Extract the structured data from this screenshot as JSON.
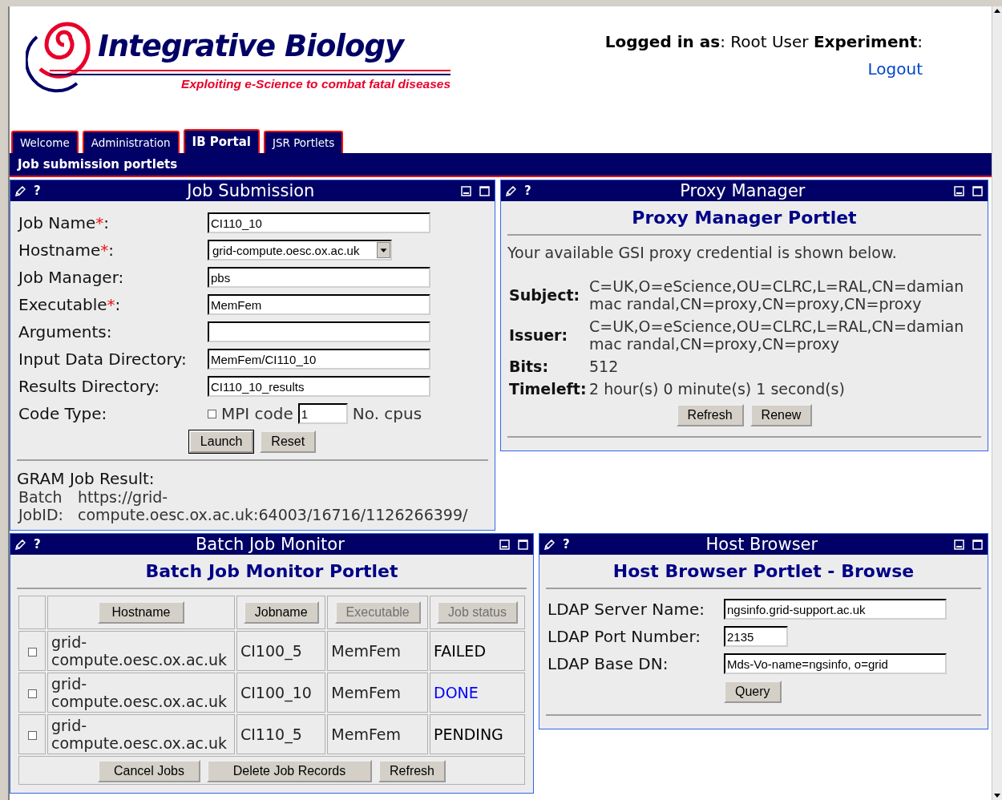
{
  "header": {
    "logo_title": "Integrative Biology",
    "logo_tagline": "Exploiting e-Science to combat fatal diseases",
    "login_text": "**Logged in as**: Root User **Experiment**:",
    "logout": "Logout"
  },
  "tabs": [
    {
      "label": "Welcome",
      "selected": false
    },
    {
      "label": "Administration",
      "selected": false
    },
    {
      "label": "IB Portal",
      "selected": true
    },
    {
      "label": "JSR Portlets",
      "selected": false
    }
  ],
  "section_title": "Job submission portlets",
  "job_submission": {
    "title": "Job Submission",
    "help": "?",
    "fields": [
      {
        "kind": "text",
        "label": "Job Name",
        "required_mark": "*",
        "suffix": ":",
        "value": "CI110_10"
      },
      {
        "kind": "select",
        "label": "Hostname",
        "required_mark": "*",
        "suffix": ":",
        "value": "grid-compute.oesc.ox.ac.uk"
      },
      {
        "kind": "text",
        "label": "Job Manager:",
        "value": "pbs"
      },
      {
        "kind": "text",
        "label": "Executable",
        "required_mark": "*",
        "suffix": ":",
        "value": "MemFem"
      },
      {
        "kind": "text",
        "label": "Arguments:"
      },
      {
        "kind": "text",
        "label": "Input Data Directory:",
        "value": "MemFem/CI110_10"
      },
      {
        "kind": "text",
        "label": "Results Directory:",
        "value": "CI110_10_results"
      },
      {
        "kind": "mpi",
        "label": "Code Type:",
        "checkbox_label": "MPI code",
        "checked": false,
        "value": "1",
        "after": "No. cpus"
      }
    ],
    "buttons": [
      "Launch",
      "Reset"
    ],
    "result": {
      "heading": "GRAM Job Result:",
      "label": "Batch JobID:",
      "value": "https://grid-compute.oesc.ox.ac.uk:64003/16716/1126266399/"
    }
  },
  "proxy_manager": {
    "title": "Proxy Manager",
    "help": "?",
    "heading": "Proxy Manager Portlet",
    "intro": "Your available GSI proxy credential is shown below.",
    "rows": [
      {
        "label": "Subject:",
        "value": "C=UK,O=eScience,OU=CLRC,L=RAL,CN=damian mac randal,CN=proxy,CN=proxy,CN=proxy"
      },
      {
        "label": "Issuer:",
        "value": "C=UK,O=eScience,OU=CLRC,L=RAL,CN=damian mac randal,CN=proxy,CN=proxy"
      },
      {
        "label": "Bits:",
        "value": "512"
      },
      {
        "label": "Timeleft:",
        "value": "2 hour(s) 0 minute(s) 1 second(s)"
      }
    ],
    "buttons": [
      "Refresh",
      "Renew"
    ]
  },
  "batch_monitor": {
    "title": "Batch Job Monitor",
    "help": "?",
    "heading": "Batch Job Monitor Portlet",
    "columns": [
      {
        "label": "Hostname",
        "disabled": false
      },
      {
        "label": "Jobname",
        "disabled": false
      },
      {
        "label": "Executable",
        "disabled": true
      },
      {
        "label": "Job status",
        "disabled": true
      }
    ],
    "rows": [
      {
        "checked": false,
        "hostname": "grid-compute.oesc.ox.ac.uk",
        "jobname": "CI100_5",
        "executable": "MemFem",
        "status": "FAILED",
        "color": "#000000"
      },
      {
        "checked": false,
        "hostname": "grid-compute.oesc.ox.ac.uk",
        "jobname": "CI100_10",
        "executable": "MemFem",
        "status": "DONE",
        "color": "#0000ff"
      },
      {
        "checked": false,
        "hostname": "grid-compute.oesc.ox.ac.uk",
        "jobname": "CI110_5",
        "executable": "MemFem",
        "status": "PENDING",
        "color": "#000000"
      }
    ],
    "buttons": [
      "Cancel Jobs",
      "Delete Job Records",
      "Refresh"
    ]
  },
  "host_browser": {
    "title": "Host Browser",
    "help": "?",
    "heading": "Host Browser Portlet - Browse",
    "fields": [
      {
        "kind": "wide",
        "label": "LDAP Server Name:",
        "value": "ngsinfo.grid-support.ac.uk"
      },
      {
        "kind": "narrow",
        "label": "LDAP Port Number:",
        "value": "2135"
      },
      {
        "kind": "wide",
        "label": "LDAP Base DN:",
        "value": "Mds-Vo-name=ngsinfo, o=grid"
      }
    ],
    "buttons": [
      "Query"
    ]
  }
}
